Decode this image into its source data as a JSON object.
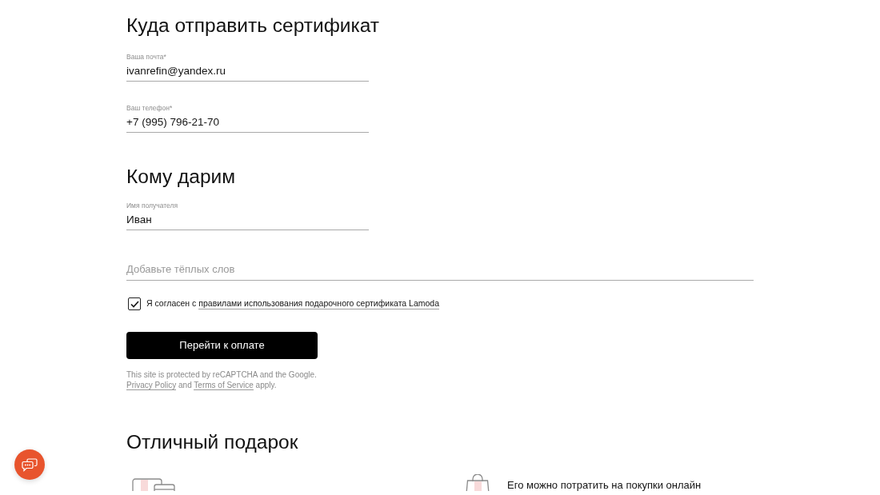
{
  "delivery": {
    "title": "Куда отправить сертификат",
    "fields": [
      {
        "label": "Ваша почта*",
        "value": "ivanrefin@yandex.ru"
      },
      {
        "label": "Ваш телефон*",
        "value": "+7 (995) 796-21-70"
      }
    ]
  },
  "recipient": {
    "title": "Кому дарим",
    "fields": [
      {
        "label": "Имя получателя",
        "value": "Иван"
      }
    ],
    "message": {
      "placeholder": "Добавьте тёплых слов"
    }
  },
  "agreement": {
    "checked": true,
    "text": "Я согласен с",
    "link": "правилами использования подарочного сертификата Lamoda"
  },
  "pay_button": "Перейти к оплате",
  "recaptcha": {
    "text": "This site is protected by reCAPTCHA and the Google.",
    "privacy_link": "Privacy Policy",
    "joiner": "and",
    "terms_link": "Terms of Service",
    "ending": "apply."
  },
  "benefits": {
    "title": "Отличный подарок",
    "items": [
      {
        "kind": "cards"
      },
      {
        "kind": "bag",
        "text": "Его можно потратить на покупки онлайн"
      }
    ]
  }
}
